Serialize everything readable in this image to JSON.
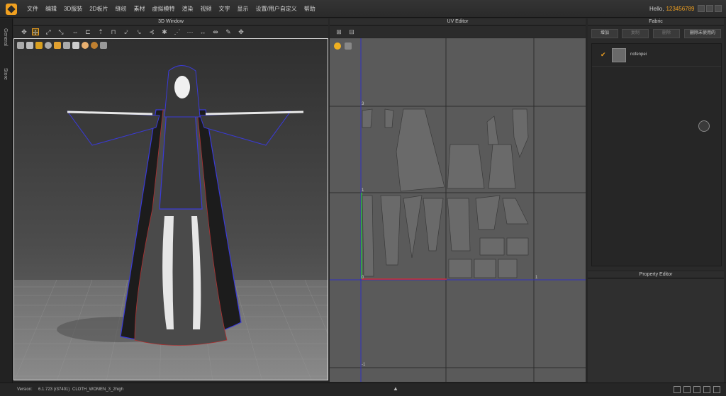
{
  "menu": {
    "items": [
      "文件",
      "编辑",
      "3D服装",
      "2D板片",
      "缝纫",
      "素材",
      "虚拟模特",
      "渲染",
      "视频",
      "文字",
      "显示",
      "设置/用户自定义",
      "帮助"
    ],
    "hello": "Hello,",
    "username": "123456789"
  },
  "left_tabs": {
    "general": "General",
    "store": "Store"
  },
  "panels": {
    "window_3d": "3D Window",
    "uv_editor": "UV Editor",
    "fabric": "Fabric",
    "property_editor": "Property Editor"
  },
  "uv_labels": {
    "v3": "3",
    "v1": "1",
    "v0": "0",
    "u1": "1",
    "v_minus1": "-1"
  },
  "fabric": {
    "buttons": {
      "add": "增加",
      "copy": "复制",
      "delete": "删除",
      "remove_unused": "删除未使用的"
    },
    "items": [
      {
        "name": "nofenpei",
        "checked": true
      }
    ]
  },
  "status": {
    "version_label": "Version:",
    "version": "6.1.723 (r37401)",
    "file": "CLOTH_WOMEN_3_2high"
  },
  "colors": {
    "accent": "#f0a020",
    "outline_blue": "#3a3ad8",
    "outline_red": "#b03030",
    "uv_axis_green": "#30c030",
    "uv_axis_red": "#d03030"
  }
}
